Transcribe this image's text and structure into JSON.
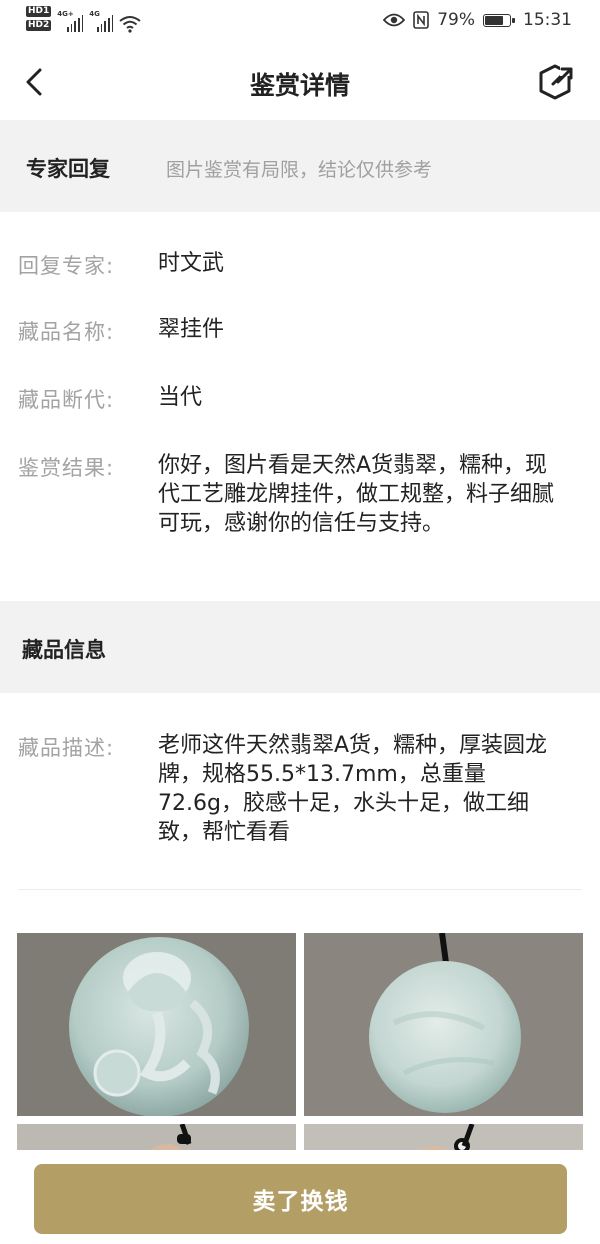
{
  "status_bar": {
    "hd1": "HD1",
    "hd2": "HD2",
    "net1": "4G+",
    "net2": "4G",
    "battery_percent": "79%",
    "battery_level": 0.79,
    "time": "15:31",
    "icons": [
      "eye-icon",
      "nfc-icon",
      "wifi-icon",
      "battery-icon"
    ]
  },
  "header": {
    "title": "鉴赏详情",
    "back_icon": "chevron-left-icon",
    "share_icon": "share-icon"
  },
  "expert_section": {
    "title": "专家回复",
    "note": "图片鉴赏有局限，结论仅供参考"
  },
  "details": [
    {
      "label": "回复专家:",
      "value": "时文武"
    },
    {
      "label": "藏品名称:",
      "value": "翠挂件"
    },
    {
      "label": "藏品断代:",
      "value": "当代"
    },
    {
      "label": "鉴赏结果:",
      "value": "你好，图片看是天然A货翡翠，糯种，现代工艺雕龙牌挂件，做工规整，料子细腻可玩，感谢你的信任与支持。"
    }
  ],
  "item_section": {
    "title": "藏品信息",
    "desc_label": "藏品描述:",
    "desc_value": "老师这件天然翡翠A货，糯种，厚装圆龙牌，规格55.5*13.7mm，总重量72.6g，胶感十足，水头十足，做工细致，帮忙看看"
  },
  "photos": [
    "jade-dragon-pendant-front",
    "jade-pendant-back",
    "jade-pendant-held",
    "jade-pendant-held"
  ],
  "colors": {
    "accent": "#b39f66",
    "band": "#f2f2f2",
    "label": "#a3a3a3"
  },
  "bottom": {
    "sell_label": "卖了换钱"
  }
}
